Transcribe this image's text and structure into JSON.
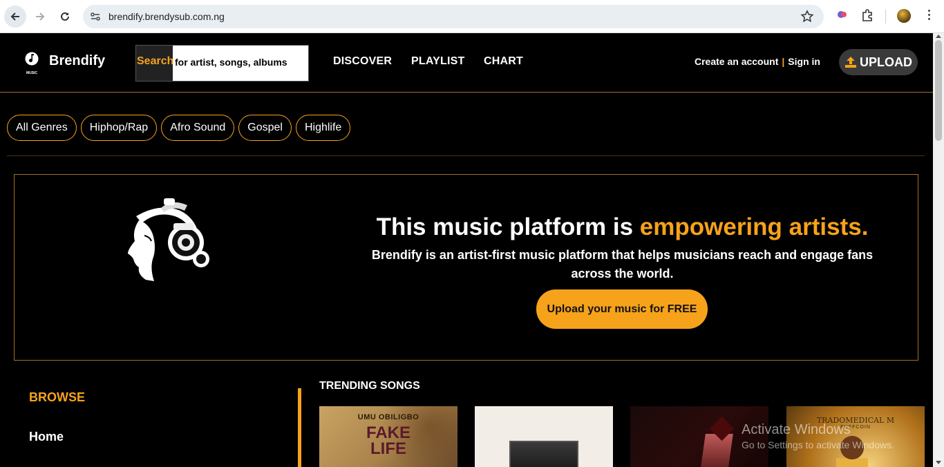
{
  "browser": {
    "url": "brendify.brendysub.com.ng"
  },
  "header": {
    "brand": "Brendify",
    "logo_caption": "MUSIC",
    "search_label": "Search",
    "search_placeholder": "for artist, songs, albums",
    "nav": [
      "DISCOVER",
      "PLAYLIST",
      "CHART"
    ],
    "create_account": "Create an account",
    "separator": "|",
    "sign_in": "Sign in",
    "upload": "UPLOAD"
  },
  "genres": [
    "All Genres",
    "Hiphop/Rap",
    "Afro Sound",
    "Gospel",
    "Highlife"
  ],
  "hero": {
    "title_start": "This music platform is ",
    "title_highlight": "empowering artists.",
    "text": "Brendify is an artist-first music platform that helps musicians reach and engage fans across the world.",
    "cta": "Upload your music for FREE"
  },
  "sidebar": {
    "title": "BROWSE",
    "items": [
      "Home"
    ]
  },
  "trending": {
    "title": "TRENDING SONGS",
    "cards": [
      {
        "artist": "UMU OBILIGBO",
        "title_line1": "FAKE",
        "title_line2": "LIFE"
      },
      {},
      {},
      {
        "artist": "TRADOMEDICAL M",
        "title": "BUFFCOIN"
      }
    ]
  },
  "watermark": {
    "line1": "Activate Windows",
    "line2": "Go to Settings to activate Windows."
  },
  "colors": {
    "accent": "#f7a21b",
    "background": "#000000"
  }
}
